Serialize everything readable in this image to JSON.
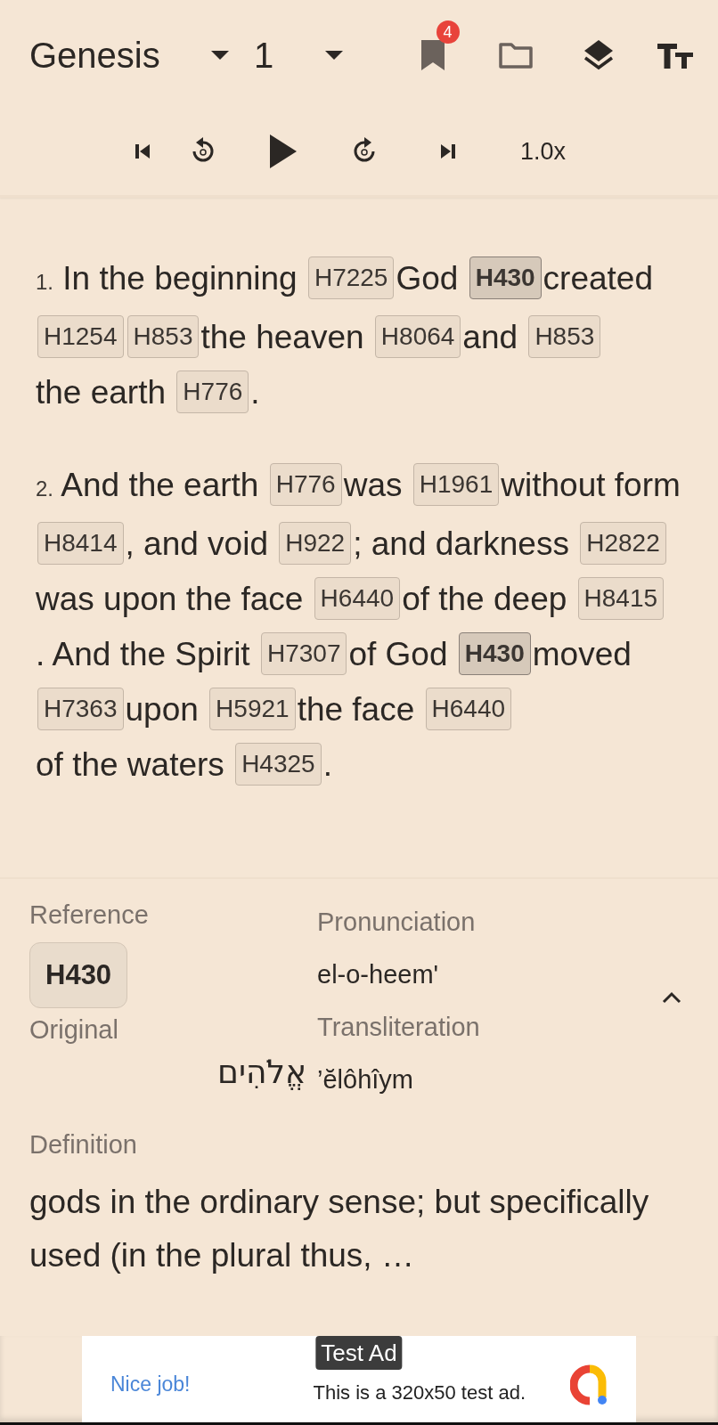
{
  "header": {
    "book": "Genesis",
    "chapter": "1",
    "bookmark_count": "4"
  },
  "player": {
    "speed": "1.0x"
  },
  "verses": [
    {
      "number": "1.",
      "segments": [
        {
          "kind": "text",
          "text": "In the beginning"
        },
        {
          "kind": "ref",
          "text": "H7225",
          "selected": false
        },
        {
          "kind": "text",
          "text": "God"
        },
        {
          "kind": "ref",
          "text": "H430",
          "selected": true
        },
        {
          "kind": "text",
          "text": "created"
        },
        {
          "kind": "ref",
          "text": "H1254",
          "selected": false
        },
        {
          "kind": "ref",
          "text": "H853",
          "selected": false
        },
        {
          "kind": "text",
          "text": "the heaven"
        },
        {
          "kind": "ref",
          "text": "H8064",
          "selected": false
        },
        {
          "kind": "text",
          "text": "and"
        },
        {
          "kind": "ref",
          "text": "H853",
          "selected": false
        },
        {
          "kind": "text",
          "text": "the earth"
        },
        {
          "kind": "ref",
          "text": "H776",
          "selected": false
        },
        {
          "kind": "text",
          "text": "."
        }
      ]
    },
    {
      "number": "2.",
      "segments": [
        {
          "kind": "text",
          "text": "And the earth"
        },
        {
          "kind": "ref",
          "text": "H776",
          "selected": false
        },
        {
          "kind": "text",
          "text": "was"
        },
        {
          "kind": "ref",
          "text": "H1961",
          "selected": false
        },
        {
          "kind": "text",
          "text": "without form"
        },
        {
          "kind": "ref",
          "text": "H8414",
          "selected": false
        },
        {
          "kind": "text",
          "text": ", and void"
        },
        {
          "kind": "ref",
          "text": "H922",
          "selected": false
        },
        {
          "kind": "text",
          "text": "; and darkness"
        },
        {
          "kind": "ref",
          "text": "H2822",
          "selected": false
        },
        {
          "kind": "text",
          "text": "was upon the face"
        },
        {
          "kind": "ref",
          "text": "H6440",
          "selected": false
        },
        {
          "kind": "text",
          "text": "of the deep"
        },
        {
          "kind": "ref",
          "text": "H8415",
          "selected": false
        },
        {
          "kind": "text",
          "text": ". And the Spirit"
        },
        {
          "kind": "ref",
          "text": "H7307",
          "selected": false
        },
        {
          "kind": "text",
          "text": "of God"
        },
        {
          "kind": "ref",
          "text": "H430",
          "selected": true
        },
        {
          "kind": "text",
          "text": "moved"
        },
        {
          "kind": "ref",
          "text": "H7363",
          "selected": false
        },
        {
          "kind": "text",
          "text": "upon"
        },
        {
          "kind": "ref",
          "text": "H5921",
          "selected": false
        },
        {
          "kind": "text",
          "text": "the face"
        },
        {
          "kind": "ref",
          "text": "H6440",
          "selected": false
        },
        {
          "kind": "text",
          "text": "of the waters"
        },
        {
          "kind": "ref",
          "text": "H4325",
          "selected": false
        },
        {
          "kind": "text",
          "text": "."
        }
      ]
    }
  ],
  "details": {
    "reference_label": "Reference",
    "reference": "H430",
    "original_label": "Original",
    "original": "אֱלֹהִים",
    "pronunciation_label": "Pronunciation",
    "pronunciation": "el-o-heem'",
    "transliteration_label": "Transliteration",
    "transliteration": "’ĕlôhîym",
    "definition_label": "Definition",
    "definition": "gods in the ordinary sense; but specifically used (in the plural thus, …"
  },
  "ad": {
    "badge": "Test Ad",
    "headline": "Nice job!",
    "text": "This is a 320x50 test ad."
  }
}
